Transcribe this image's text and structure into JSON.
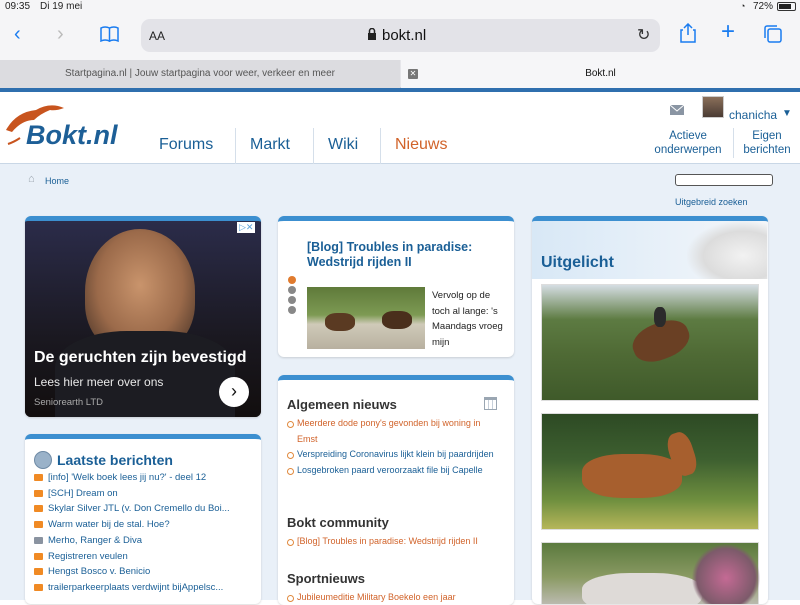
{
  "status": {
    "time": "09:35",
    "date": "Di 19 mei",
    "battery": "72%"
  },
  "browser": {
    "text_size": "AA",
    "url": "bokt.nl",
    "tabs": [
      {
        "title": "Startpagina.nl | Jouw startpagina voor weer, verkeer en meer"
      },
      {
        "title": "Bokt.nl"
      }
    ]
  },
  "site": {
    "logo": "Bokt.nl",
    "nav": [
      "Forums",
      "Markt",
      "Wiki",
      "Nieuws"
    ],
    "user": "chanicha",
    "user_links": [
      "Actieve onderwerpen",
      "Eigen berichten"
    ],
    "breadcrumb": "Home",
    "adv_search": "Uitgebreid zoeken",
    "ad": {
      "headline": "De geruchten zijn bevestigd",
      "sub": "Lees hier meer over ons",
      "source": "Seniorearth LTD"
    },
    "blog": {
      "title": "[Blog] Troubles in paradise: Wedstrijd rijden II",
      "text": "Vervolg op de toch al lange: 's Maandags vroeg mijn"
    },
    "laatste": {
      "title": "Laatste berichten",
      "items": [
        "[info] 'Welk boek lees jij nu?' - deel 12",
        "[SCH] Dream on",
        "Skylar Silver JTL (v. Don Cremello du Boi...",
        "Warm water bij de stal. Hoe?",
        "Merho, Ranger & Diva",
        "Registreren veulen",
        "Hengst Bosco v. Benicio",
        "trailerparkeerplaats verdwijnt bijAppelsc..."
      ]
    },
    "news": {
      "algemeen_title": "Algemeen nieuws",
      "algemeen": [
        "Meerdere dode pony's gevonden bij woning in Emst",
        "Verspreiding Coronavirus lijkt klein bij paardrijden",
        "Losgebroken paard veroorzaakt file bij Capelle"
      ],
      "community_title": "Bokt community",
      "community": [
        "[Blog] Troubles in paradise: Wedstrijd rijden II"
      ],
      "sport_title": "Sportnieuws",
      "sport": [
        "Jubileumeditie Military Boekelo een jaar"
      ]
    },
    "uitgelicht": "Uitgelicht"
  }
}
